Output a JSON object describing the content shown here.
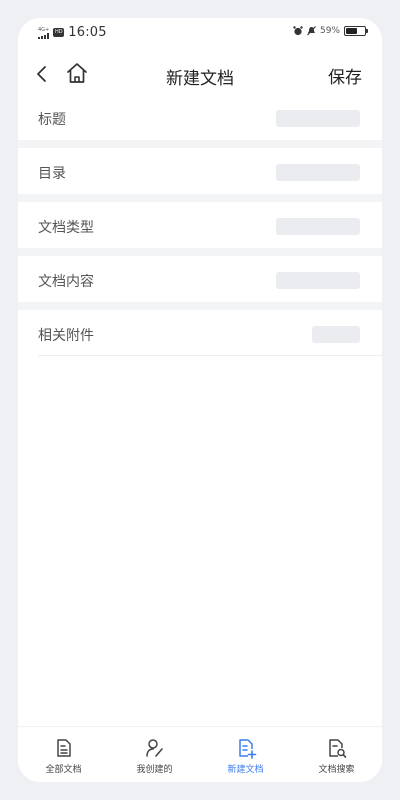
{
  "status_bar": {
    "network": "4G+",
    "hd": "HD",
    "time": "16:05",
    "battery_pct": "59%",
    "battery_level": 0.59
  },
  "nav": {
    "title": "新建文档",
    "save_label": "保存"
  },
  "form": {
    "rows": [
      {
        "label": "标题"
      },
      {
        "label": "目录"
      },
      {
        "label": "文档类型"
      },
      {
        "label": "文档内容"
      },
      {
        "label": "相关附件"
      }
    ]
  },
  "tabs": [
    {
      "label": "全部文档",
      "icon": "document-list-icon",
      "active": false
    },
    {
      "label": "我创建的",
      "icon": "user-edit-icon",
      "active": false
    },
    {
      "label": "新建文档",
      "icon": "document-add-icon",
      "active": true
    },
    {
      "label": "文档搜索",
      "icon": "document-search-icon",
      "active": false
    }
  ],
  "colors": {
    "accent": "#3d7cf0",
    "placeholder": "#ebecef",
    "background": "#eef0f3"
  }
}
